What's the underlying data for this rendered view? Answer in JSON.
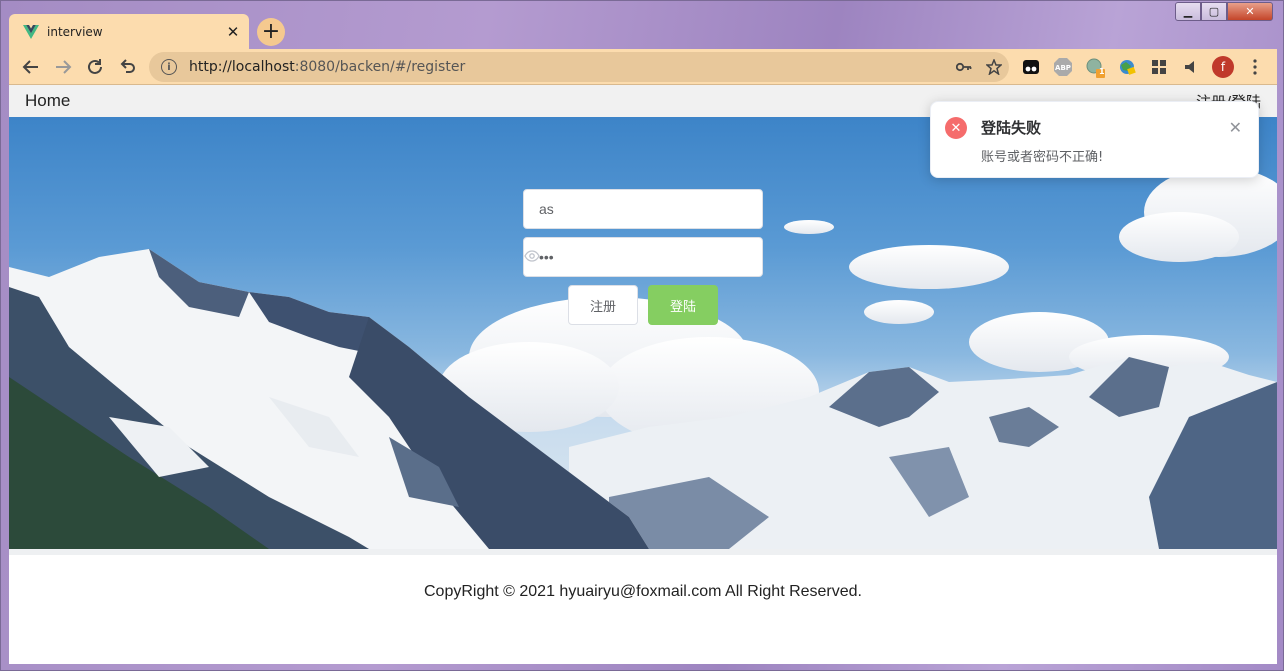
{
  "browser": {
    "tab_title": "interview",
    "tab_close": "✕",
    "new_tab": "+",
    "url_host": "http://localhost",
    "url_rest": ":8080/backen/#/register",
    "profile_initial": "f",
    "ext_badge": "1",
    "info_glyph": "i",
    "window_controls": {
      "minimize": "▁",
      "maximize": "▢",
      "close": "✕"
    }
  },
  "page": {
    "nav_home": "Home",
    "nav_auth": "注册/登陆",
    "form": {
      "username_value": "as",
      "password_value": "•••"
    },
    "buttons": {
      "register": "注册",
      "login": "登陆"
    },
    "footer": "CopyRight © 2021 hyuairyu@foxmail.com All Right Reserved."
  },
  "notification": {
    "type": "error",
    "icon": "✕",
    "title": "登陆失败",
    "message": "账号或者密码不正确!",
    "close": "✕",
    "color": "#f56c6c"
  },
  "colors": {
    "login_button": "#85ce61",
    "tab_bg": "#fcdcae",
    "omnibox_bg": "#e8c89b"
  }
}
